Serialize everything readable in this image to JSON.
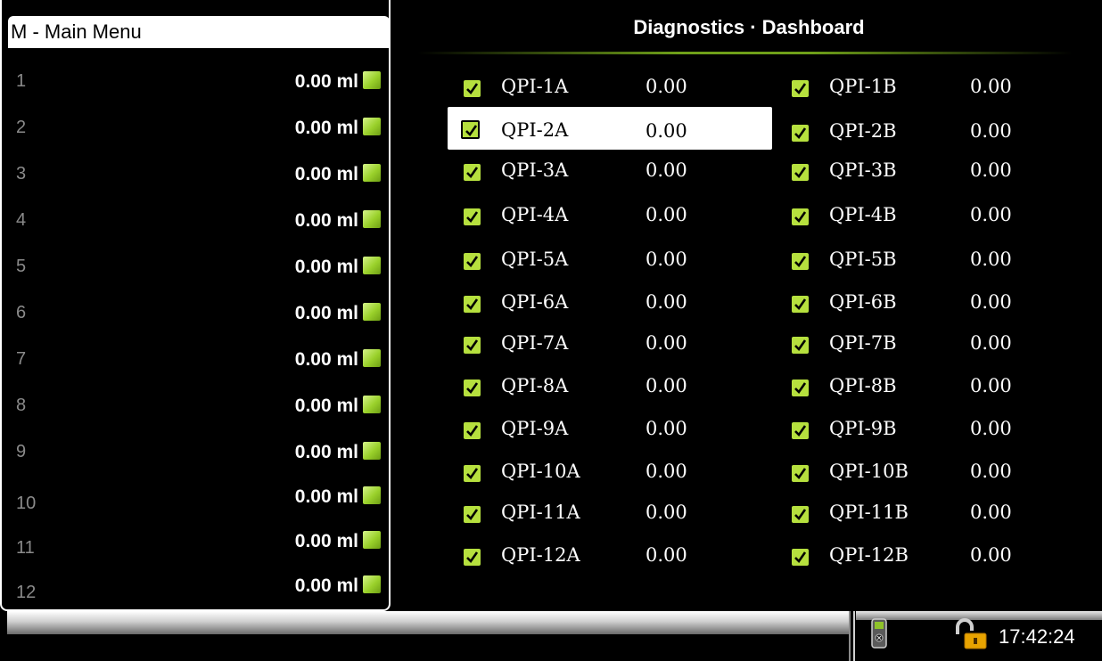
{
  "menu": {
    "label": "M - Main Menu"
  },
  "channels": [
    {
      "num": "1",
      "value": "0.00 ml"
    },
    {
      "num": "2",
      "value": "0.00 ml"
    },
    {
      "num": "3",
      "value": "0.00 ml"
    },
    {
      "num": "4",
      "value": "0.00 ml"
    },
    {
      "num": "5",
      "value": "0.00 ml"
    },
    {
      "num": "6",
      "value": "0.00 ml"
    },
    {
      "num": "7",
      "value": "0.00 ml"
    },
    {
      "num": "8",
      "value": "0.00 ml"
    },
    {
      "num": "9",
      "value": "0.00 ml"
    },
    {
      "num": "10",
      "value": "0.00 ml"
    },
    {
      "num": "11",
      "value": "0.00 ml"
    },
    {
      "num": "12",
      "value": "0.00 ml"
    }
  ],
  "dashboard": {
    "title": "Diagnostics · Dashboard",
    "column_a": [
      {
        "label": "QPI-1A",
        "value": "0.00",
        "checked": true
      },
      {
        "label": "QPI-2A",
        "value": "0.00",
        "checked": true,
        "selected": true
      },
      {
        "label": "QPI-3A",
        "value": "0.00",
        "checked": true
      },
      {
        "label": "QPI-4A",
        "value": "0.00",
        "checked": true
      },
      {
        "label": "QPI-5A",
        "value": "0.00",
        "checked": true
      },
      {
        "label": "QPI-6A",
        "value": "0.00",
        "checked": true
      },
      {
        "label": "QPI-7A",
        "value": "0.00",
        "checked": true
      },
      {
        "label": "QPI-8A",
        "value": "0.00",
        "checked": true
      },
      {
        "label": "QPI-9A",
        "value": "0.00",
        "checked": true
      },
      {
        "label": "QPI-10A",
        "value": "0.00",
        "checked": true
      },
      {
        "label": "QPI-11A",
        "value": "0.00",
        "checked": true
      },
      {
        "label": "QPI-12A",
        "value": "0.00",
        "checked": true
      }
    ],
    "column_b": [
      {
        "label": "QPI-1B",
        "value": "0.00",
        "checked": true
      },
      {
        "label": "QPI-2B",
        "value": "0.00",
        "checked": true
      },
      {
        "label": "QPI-3B",
        "value": "0.00",
        "checked": true
      },
      {
        "label": "QPI-4B",
        "value": "0.00",
        "checked": true
      },
      {
        "label": "QPI-5B",
        "value": "0.00",
        "checked": true
      },
      {
        "label": "QPI-6B",
        "value": "0.00",
        "checked": true
      },
      {
        "label": "QPI-7B",
        "value": "0.00",
        "checked": true
      },
      {
        "label": "QPI-8B",
        "value": "0.00",
        "checked": true
      },
      {
        "label": "QPI-9B",
        "value": "0.00",
        "checked": true
      },
      {
        "label": "QPI-10B",
        "value": "0.00",
        "checked": true
      },
      {
        "label": "QPI-11B",
        "value": "0.00",
        "checked": true
      },
      {
        "label": "QPI-12B",
        "value": "0.00",
        "checked": true
      }
    ]
  },
  "status": {
    "time": "17:42:24",
    "icons": [
      "device-icon",
      "lock-icon"
    ]
  },
  "colors": {
    "accent": "#b6e03e",
    "led": "#9ad12b",
    "underline": "#6fa019"
  }
}
